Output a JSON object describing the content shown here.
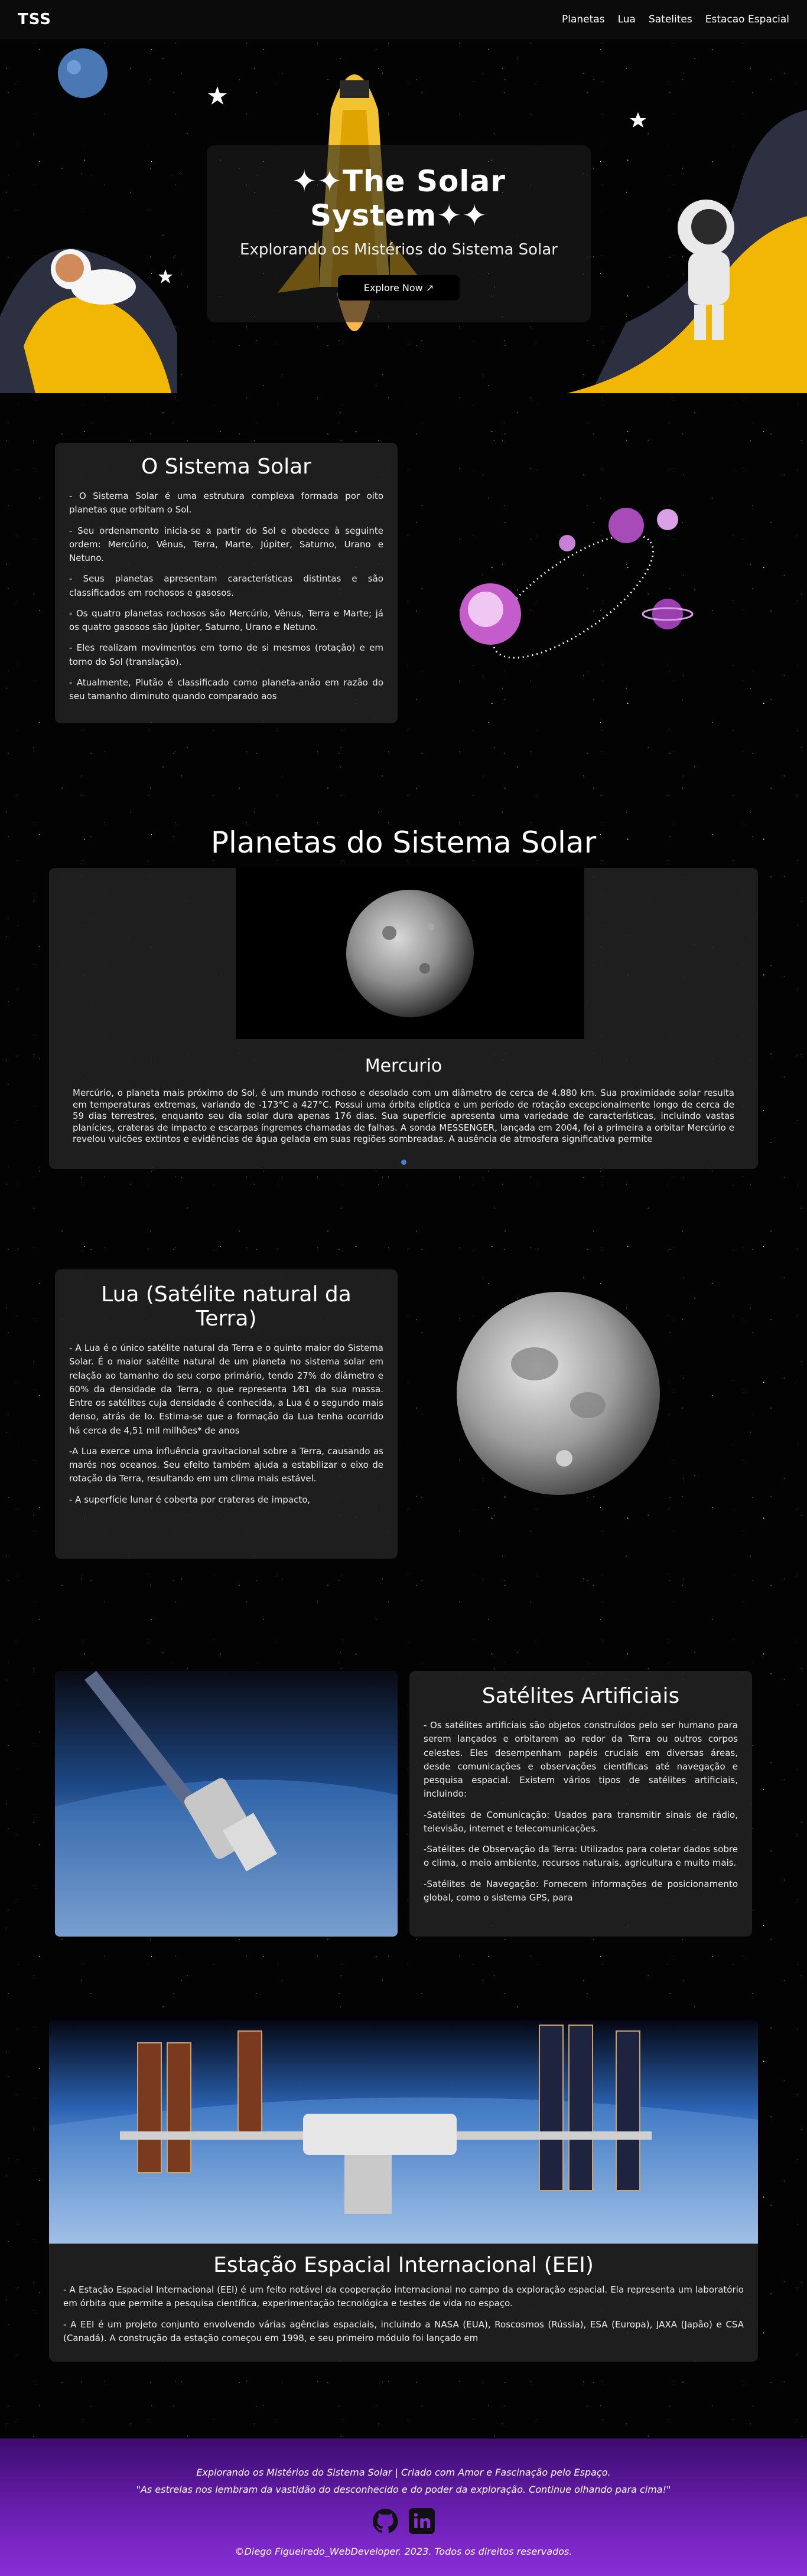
{
  "nav": {
    "brand": "TSS",
    "links": [
      "Planetas",
      "Lua",
      "Satelites",
      "Estacao Espacial"
    ]
  },
  "hero": {
    "title": "✦✦The Solar System✦✦",
    "subtitle": "Explorando os Mistérios do Sistema Solar",
    "button": "Explore Now ↗"
  },
  "sistema_solar": {
    "title": "O Sistema Solar",
    "paragraphs": [
      "- O Sistema Solar é uma estrutura complexa formada por oito planetas que orbitam o Sol.",
      "- Seu ordenamento inicia-se a partir do Sol e obedece à seguinte ordem: Mercúrio, Vênus, Terra, Marte, Júpiter, Saturno, Urano e Netuno.",
      "- Seus planetas apresentam características distintas e são classificados em rochosos e gasosos.",
      "- Os quatro planetas rochosos são Mercúrio, Vênus, Terra e Marte; já os quatro gasosos são Júpiter, Saturno, Urano e Netuno.",
      "- Eles realizam movimentos em torno de si mesmos (rotação) e em torno do Sol (translação).",
      "- Atualmente, Plutão é classificado como planeta-anão em razão do seu tamanho diminuto quando comparado aos"
    ]
  },
  "planetas": {
    "section_title": "Planetas do Sistema Solar",
    "name": "Mercurio",
    "description": "Mercúrio, o planeta mais próximo do Sol, é um mundo rochoso e desolado com um diâmetro de cerca de 4.880 km. Sua proximidade solar resulta em temperaturas extremas, variando de -173°C a 427°C. Possui uma órbita elíptica e um período de rotação excepcionalmente longo de cerca de 59 dias terrestres, enquanto seu dia solar dura apenas 176 dias. Sua superfície apresenta uma variedade de características, incluindo vastas planícies, crateras de impacto e escarpas íngremes chamadas de falhas. A sonda MESSENGER, lançada em 2004, foi a primeira a orbitar Mercúrio e revelou vulcões extintos e evidências de água gelada em suas regiões sombreadas. A ausência de atmosfera significativa permite"
  },
  "lua": {
    "title": "Lua (Satélite natural da Terra)",
    "paragraphs": [
      "- A Lua é o único satélite natural da Terra e o quinto maior do Sistema Solar. É o maior satélite natural de um planeta no sistema solar em relação ao tamanho do seu corpo primário, tendo 27% do diâmetro e 60% da densidade da Terra, o que representa 1⁄81 da sua massa. Entre os satélites cuja densidade é conhecida, a Lua é o segundo mais denso, atrás de Io. Estima-se que a formação da Lua tenha ocorrido há cerca de 4,51 mil milhões* de anos",
      "-A Lua exerce uma influência gravitacional sobre a Terra, causando as marés nos oceanos. Seu efeito também ajuda a estabilizar o eixo de rotação da Terra, resultando em um clima mais estável.",
      "- A superfície lunar é coberta por crateras de impacto,"
    ]
  },
  "satelites": {
    "title": "Satélites Artificiais",
    "paragraphs": [
      "- Os satélites artificiais são objetos construídos pelo ser humano para serem lançados e orbitarem ao redor da Terra ou outros corpos celestes. Eles desempenham papéis cruciais em diversas áreas, desde comunicações e observações científicas até navegação e pesquisa espacial. Existem vários tipos de satélites artificiais, incluindo:",
      "-Satélites de Comunicação: Usados para transmitir sinais de rádio, televisão, internet e telecomunicações.",
      "-Satélites de Observação da Terra: Utilizados para coletar dados sobre o clima, o meio ambiente, recursos naturais, agricultura e muito mais.",
      "-Satélites de Navegação: Fornecem informações de posicionamento global, como o sistema GPS, para"
    ]
  },
  "estacao": {
    "title": "Estação Espacial Internacional (EEI)",
    "paragraphs": [
      "- A Estação Espacial Internacional (EEI) é um feito notável da cooperação internacional no campo da exploração espacial. Ela representa um laboratório em órbita que permite a pesquisa científica, experimentação tecnológica e testes de vida no espaço.",
      "- A EEI é um projeto conjunto envolvendo várias agências espaciais, incluindo a NASA (EUA), Roscosmos (Rússia), ESA (Europa), JAXA (Japão) e CSA (Canadá). A construção da estação começou em 1998, e seu primeiro módulo foi lançado em"
    ]
  },
  "footer": {
    "line1": "Explorando os Mistérios do Sistema Solar | Criado com Amor e Fascinação pelo Espaço.",
    "line2": "\"As estrelas nos lembram da vastidão do desconhecido e do poder da exploração. Continue olhando para cima!\"",
    "copyright": "©Diego Figueiredo_WebDeveloper. 2023. Todos os direitos reservados."
  }
}
